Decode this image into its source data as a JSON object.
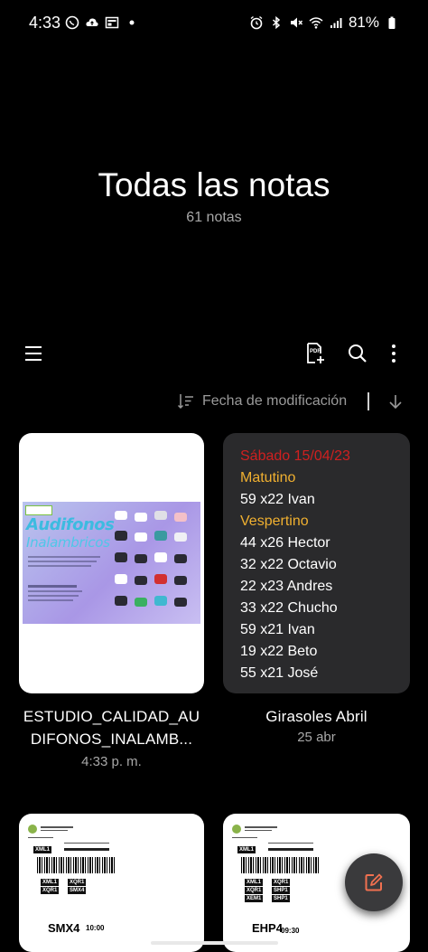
{
  "status_bar": {
    "time": "4:33",
    "battery": "81%",
    "left_icons": [
      "whatsapp-icon",
      "cloud-upload-icon",
      "news-icon",
      "dot-icon"
    ],
    "right_icons": [
      "alarm-icon",
      "bluetooth-icon",
      "mute-icon",
      "wifi-icon",
      "signal-icon",
      "battery-icon"
    ]
  },
  "header": {
    "title": "Todas las notas",
    "count": "61 notas"
  },
  "toolbar": {
    "icons": [
      "menu-icon",
      "pdf-add-icon",
      "search-icon",
      "more-vert-icon"
    ]
  },
  "sort": {
    "label": "Fecha de modificación",
    "direction": "descending"
  },
  "notes": [
    {
      "title_line1": "ESTUDIO_CALIDAD_AU",
      "title_line2": "DIFONOS_INALAMB...",
      "date": "4:33 p. m.",
      "thumbnail": {
        "flyer_title": "Audifonos",
        "flyer_sub": "Inalambricos"
      }
    },
    {
      "title": "Girasoles Abril",
      "date": "25 abr",
      "lines": [
        {
          "text": "Sábado 15/04/23",
          "color": "#d02020"
        },
        {
          "text": "Matutino",
          "color": "#f0b030"
        },
        {
          "text": "59 x22 Ivan",
          "color": "#ffffff"
        },
        {
          "text": "Vespertino",
          "color": "#f0b030"
        },
        {
          "text": "44 x26 Hector",
          "color": "#ffffff"
        },
        {
          "text": "32 x22 Octavio",
          "color": "#ffffff"
        },
        {
          "text": "22 x23 Andres",
          "color": "#ffffff"
        },
        {
          "text": "33 x22 Chucho",
          "color": "#ffffff"
        },
        {
          "text": "59 x21 Ivan",
          "color": "#ffffff"
        },
        {
          "text": "19 x22 Beto",
          "color": "#ffffff"
        },
        {
          "text": "55 x21 José",
          "color": "#ffffff"
        }
      ]
    },
    {
      "label": {
        "code": "XML1",
        "row1": [
          "XML1",
          "XQR1"
        ],
        "row2": [
          "XQR1",
          "SMX4"
        ],
        "big": "SMX4",
        "time": "10:00"
      }
    },
    {
      "label": {
        "code": "XML1",
        "row1": [
          "XML1",
          "XQR1"
        ],
        "row2": [
          "XQR1",
          "SHP1"
        ],
        "row3": [
          "XEM1",
          "SHP1"
        ],
        "big": "EHP4",
        "time": "09:30"
      }
    }
  ],
  "fab": {
    "icon": "compose-icon",
    "accent": "#f07050"
  },
  "colors": {
    "background": "#000000",
    "card_dark": "#2a2a2c",
    "secondary_text": "#a8a8a8"
  }
}
